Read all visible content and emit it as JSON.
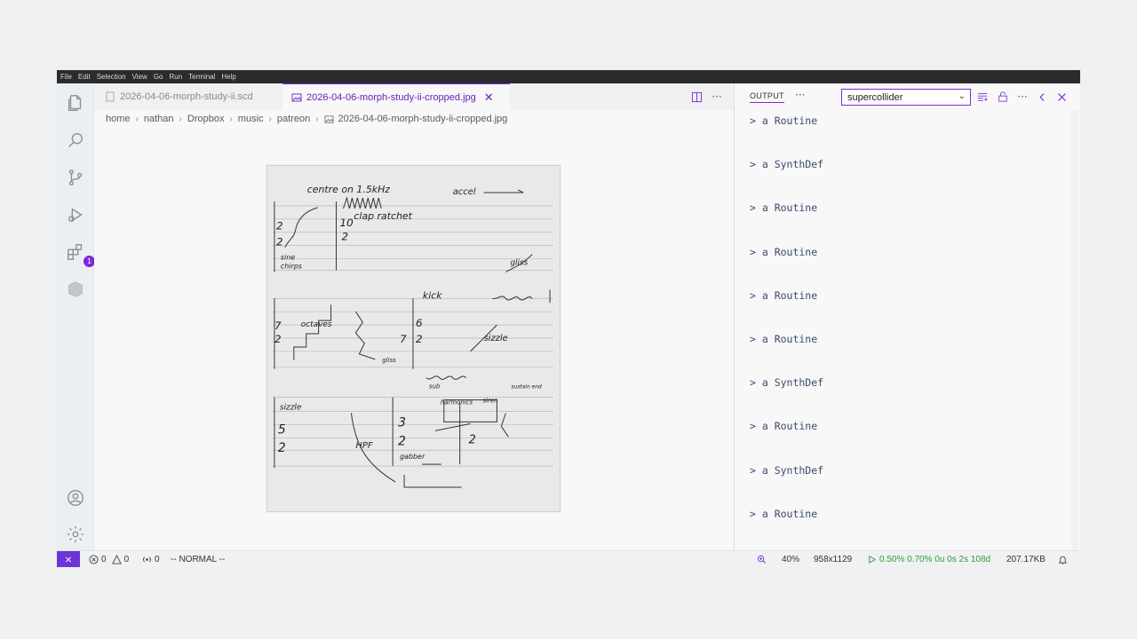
{
  "menubar": [
    "File",
    "Edit",
    "Selection",
    "View",
    "Go",
    "Run",
    "Terminal",
    "Help"
  ],
  "activity": {
    "items": [
      "explorer-icon",
      "search-icon",
      "source-control-icon",
      "run-debug-icon",
      "extensions-icon",
      "supercollider-icon"
    ],
    "extensions_badge": "1",
    "bottom": [
      "account-icon",
      "settings-gear-icon"
    ]
  },
  "tabs": [
    {
      "label": "2026-04-06-morph-study-ii.scd",
      "active": false
    },
    {
      "label": "2026-04-06-morph-study-ii-cropped.jpg",
      "active": true,
      "close": "✕"
    }
  ],
  "breadcrumb": [
    "home",
    "nathan",
    "Dropbox",
    "music",
    "patreon",
    "2026-04-06-morph-study-ii-cropped.jpg"
  ],
  "sketch_text": {
    "t1": "centre on 1.5kHz",
    "t2": "accel",
    "t3": "clap ratchet",
    "t4": "2",
    "t5": "2",
    "t6": "10",
    "t7": "2",
    "t8": "sine",
    "t9": "chirps",
    "t10": "gliss",
    "t11": "kick",
    "t12": "7",
    "t13": "2",
    "t14": "octaves",
    "t15": "6",
    "t16": "2",
    "t17": "7",
    "t18": "sizzle",
    "t19": "gliss",
    "t20": "sub",
    "t21": "sizzle",
    "t22": "5",
    "t23": "2",
    "t24": "3",
    "t25": "2",
    "t26": "harmonics",
    "t27": "siren",
    "t28": "sustain end",
    "t29": "HPF",
    "t30": "gabber",
    "t31": "2"
  },
  "panel": {
    "title": "OUTPUT",
    "more": "···",
    "channel": "supercollider",
    "lines": [
      "> a Routine",
      "> a SynthDef",
      "> a Routine",
      "> a Routine",
      "> a Routine",
      "> a Routine",
      "> a SynthDef",
      "> a Routine",
      "> a SynthDef",
      "> a Routine"
    ]
  },
  "editor_more": "···",
  "status": {
    "errors": "0",
    "warnings": "0",
    "ports": "0",
    "mode": "-- NORMAL --",
    "zoom": "40%",
    "dimensions": "958x1129",
    "sc_status": "0.50% 0.70% 0u 0s 2s 108d",
    "filesize": "207.17KB"
  },
  "colors": {
    "accent": "#7a2bd6",
    "status_green": "#2e9c3a",
    "remote": "#6c34d6"
  }
}
